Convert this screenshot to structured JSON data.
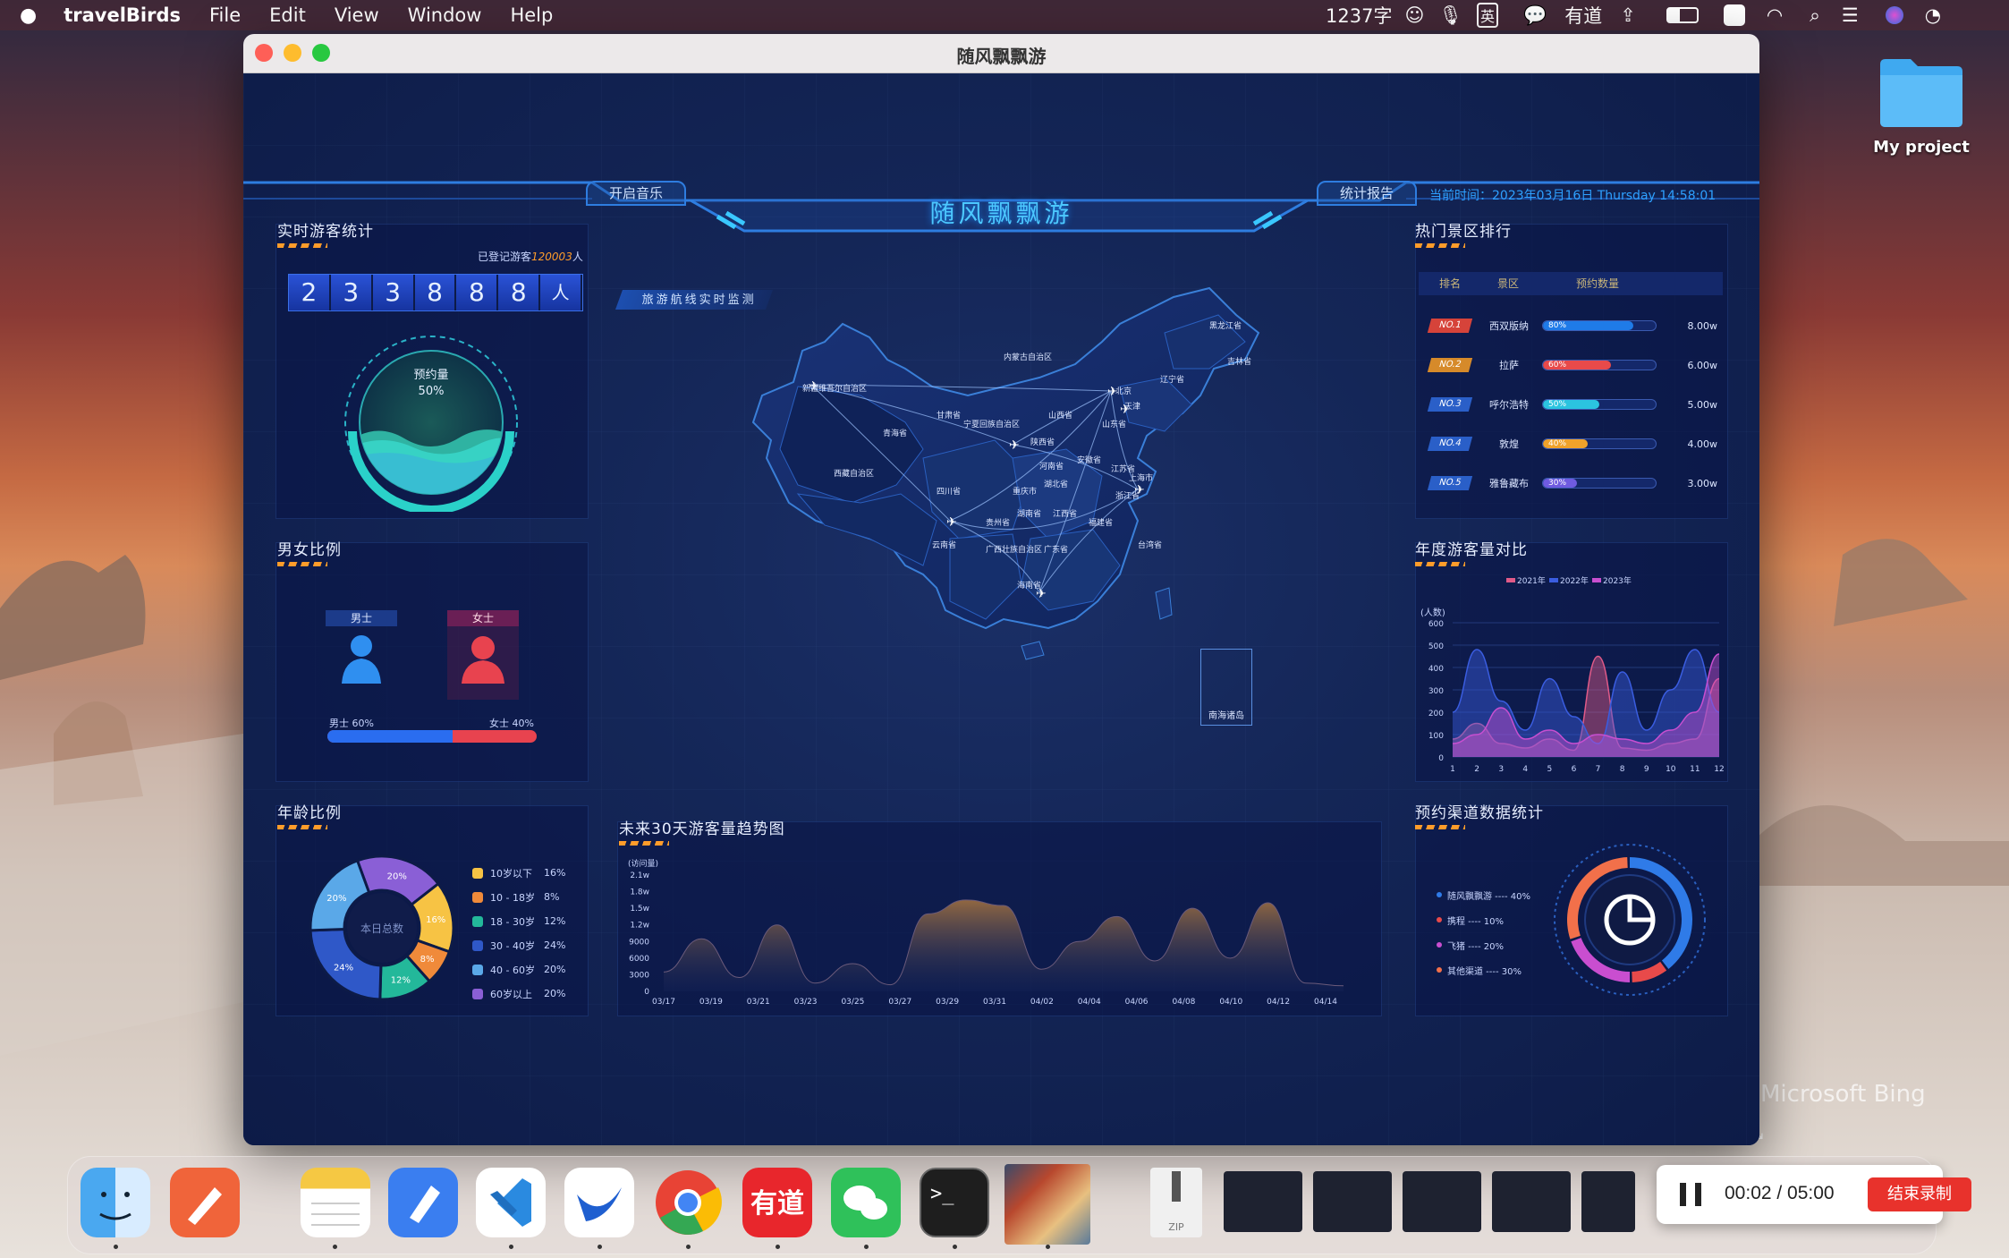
{
  "menubar": {
    "app_name": "travelBirds",
    "menus": [
      "File",
      "Edit",
      "View",
      "Window",
      "Help"
    ],
    "word_count": "1237字",
    "input_method": "英",
    "youdao": "有道"
  },
  "desktop": {
    "folder_label": "My project",
    "watermark": "Microsoft Bing"
  },
  "window": {
    "title": "随风飘飘游"
  },
  "dashboard": {
    "title": "随风飘飘游",
    "music_button": "开启音乐",
    "report_button": "统计报告",
    "time_label": "当前时间：",
    "time_value": "2023年03月16日 Thursday 14:58:01",
    "realtime": {
      "title": "实时游客统计",
      "registered_label": "已登记游客",
      "registered_value": "120003",
      "registered_unit": "人",
      "digits": [
        "2",
        "3",
        "3",
        "8",
        "8",
        "8"
      ],
      "unit": "人",
      "ball_label": "预约量",
      "ball_percent": "50%",
      "ball_value": 0.5
    },
    "gender": {
      "title": "男女比例",
      "male": "男士",
      "female": "女士",
      "male_pct": "男士 60%",
      "female_pct": "女士 40%",
      "male_value": 0.6
    },
    "age": {
      "title": "年龄比例",
      "center": "本日总数",
      "legend": [
        {
          "label": "10岁以下",
          "pct": "16%",
          "color": "#f7c344"
        },
        {
          "label": "10 - 18岁",
          "pct": "8%",
          "color": "#f08a3a"
        },
        {
          "label": "18 - 30岁",
          "pct": "12%",
          "color": "#23b89a"
        },
        {
          "label": "30 - 40岁",
          "pct": "24%",
          "color": "#2f58c8"
        },
        {
          "label": "40 - 60岁",
          "pct": "20%",
          "color": "#5aa8e8"
        },
        {
          "label": "60岁以上",
          "pct": "20%",
          "color": "#8a5fd6"
        }
      ],
      "slice_labels": [
        "20%",
        "16%",
        "8%",
        "12%",
        "24%",
        "20%"
      ]
    },
    "map": {
      "tag": "旅游航线实时监测",
      "south_sea": "南海诸岛",
      "provinces": [
        "黑龙江省",
        "内蒙古自治区",
        "吉林省",
        "辽宁省",
        "新疆维吾尔自治区",
        "甘肃省",
        "宁夏回族自治区",
        "山西省",
        "北京",
        "天津",
        "山东省",
        "青海省",
        "陕西省",
        "河南省",
        "西藏自治区",
        "四川省",
        "重庆市",
        "湖北省",
        "安徽省",
        "江苏省",
        "上海市",
        "浙江省",
        "湖南省",
        "江西省",
        "贵州省",
        "福建省",
        "云南省",
        "广西壮族自治区",
        "广东省",
        "台湾省",
        "海南省"
      ]
    },
    "ranking": {
      "title": "热门景区排行",
      "headers": [
        "排名",
        "景区",
        "预约数量"
      ],
      "rows": [
        {
          "rank": "NO.1",
          "name": "西双版纳",
          "pct": "80%",
          "value": "8.00w",
          "fill": 0.8,
          "color": "#1f7be8",
          "badge": "#d6433a"
        },
        {
          "rank": "NO.2",
          "name": "拉萨",
          "pct": "60%",
          "value": "6.00w",
          "fill": 0.6,
          "color": "#e84a4a",
          "badge": "#d68a2a"
        },
        {
          "rank": "NO.3",
          "name": "呼尔浩特",
          "pct": "50%",
          "value": "5.00w",
          "fill": 0.5,
          "color": "#2bc4e0",
          "badge": "#2a5fc8"
        },
        {
          "rank": "NO.4",
          "name": "敦煌",
          "pct": "40%",
          "value": "4.00w",
          "fill": 0.4,
          "color": "#f0a22a",
          "badge": "#2a5fc8"
        },
        {
          "rank": "NO.5",
          "name": "雅鲁藏布",
          "pct": "30%",
          "value": "3.00w",
          "fill": 0.3,
          "color": "#6f5be0",
          "badge": "#2a5fc8"
        }
      ]
    },
    "annual": {
      "title": "年度游客量对比"
    },
    "trend": {
      "title": "未来30天游客量趋势图"
    },
    "channel": {
      "title": "预约渠道数据统计",
      "legend": [
        {
          "label": "随风飘飘游 ---- 40%",
          "color": "#2f7be8"
        },
        {
          "label": "携程 ---- 10%",
          "color": "#e84a4a"
        },
        {
          "label": "飞猪 ---- 20%",
          "color": "#c94ed0"
        },
        {
          "label": "其他渠道 ---- 30%",
          "color": "#f2704a"
        }
      ],
      "values": [
        0.4,
        0.1,
        0.2,
        0.3
      ]
    }
  },
  "chart_data": [
    {
      "type": "area",
      "title": "年度游客量对比",
      "ylabel": "(人数)",
      "ylim": [
        0,
        600
      ],
      "yticks": [
        "600",
        "500",
        "400",
        "300",
        "200",
        "100",
        "0"
      ],
      "categories": [
        "1",
        "2",
        "3",
        "4",
        "5",
        "6",
        "7",
        "8",
        "9",
        "10",
        "11",
        "12"
      ],
      "series": [
        {
          "name": "2021年",
          "color": "#e05a88",
          "values": [
            80,
            150,
            60,
            40,
            80,
            30,
            450,
            40,
            30,
            60,
            80,
            350
          ]
        },
        {
          "name": "2022年",
          "color": "#3a5de0",
          "values": [
            200,
            480,
            250,
            120,
            350,
            180,
            60,
            380,
            120,
            300,
            480,
            200
          ]
        },
        {
          "name": "2023年",
          "color": "#c84fd0",
          "values": [
            60,
            100,
            220,
            80,
            120,
            60,
            100,
            80,
            60,
            120,
            200,
            460
          ]
        }
      ]
    },
    {
      "type": "area",
      "title": "未来30天游客量趋势图",
      "ylabel": "(访问量)",
      "ylim": [
        0,
        21000
      ],
      "yticks": [
        "2.1w",
        "1.8w",
        "1.5w",
        "1.2w",
        "9000",
        "6000",
        "3000",
        "0"
      ],
      "x": [
        "03/17",
        "03/19",
        "03/21",
        "03/23",
        "03/25",
        "03/27",
        "03/29",
        "03/31",
        "04/02",
        "04/04",
        "04/06",
        "04/08",
        "04/10",
        "04/12",
        "04/14"
      ],
      "values": [
        3500,
        9500,
        2500,
        12000,
        1500,
        5000,
        1200,
        14000,
        16500,
        15500,
        4000,
        9000,
        13500,
        5500,
        15000,
        6000,
        16000,
        1500,
        1000
      ]
    }
  ],
  "dock": {
    "zip_label": "ZIP",
    "recording_time": "00:02 / 05:00",
    "stop_button": "结束录制"
  }
}
